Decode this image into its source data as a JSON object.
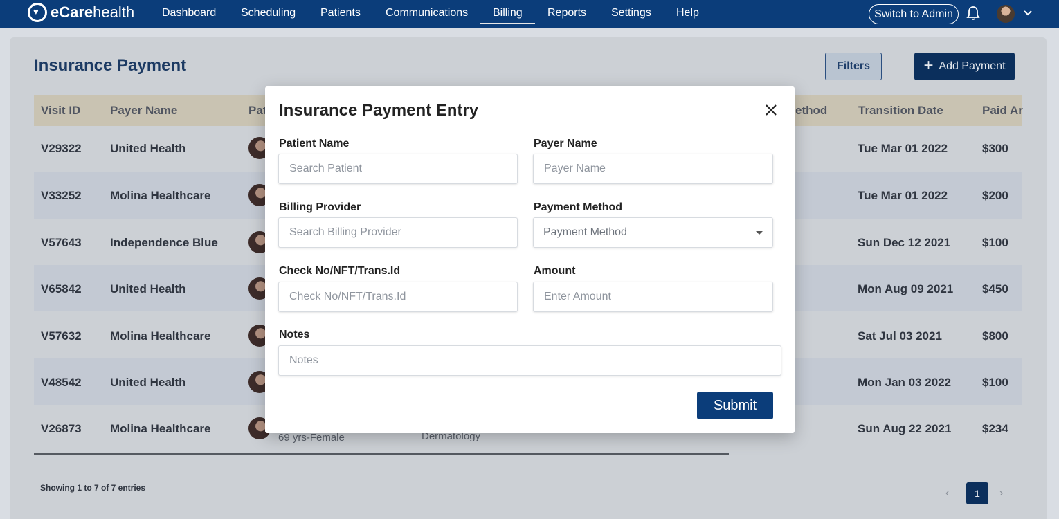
{
  "nav": {
    "brand_bold": "eCare",
    "brand_light": "health",
    "items": [
      "Dashboard",
      "Scheduling",
      "Patients",
      "Communications",
      "Billing",
      "Reports",
      "Settings",
      "Help"
    ],
    "active": "Billing",
    "switch_admin": "Switch to Admin"
  },
  "page": {
    "title": "Insurance Payment",
    "filters_label": "Filters",
    "add_payment_label": "Add Payment"
  },
  "table": {
    "headers": [
      "Visit ID",
      "Payer Name",
      "Pat",
      "ethod",
      "Transition Date",
      "Paid Ar"
    ],
    "rows": [
      {
        "visit_id": "V29322",
        "payer": "United Health",
        "date": "Tue Mar 01 2022",
        "paid": "$300"
      },
      {
        "visit_id": "V33252",
        "payer": "Molina Healthcare",
        "date": "Tue Mar 01 2022",
        "paid": "$200"
      },
      {
        "visit_id": "V57643",
        "payer": "Independence Blue",
        "date": "Sun Dec 12 2021",
        "paid": "$100"
      },
      {
        "visit_id": "V65842",
        "payer": "United Health",
        "date": "Mon Aug 09 2021",
        "paid": "$450"
      },
      {
        "visit_id": "V57632",
        "payer": "Molina Healthcare",
        "date": "Sat Jul 03 2021",
        "paid": "$800"
      },
      {
        "visit_id": "V48542",
        "payer": "United Health",
        "date": "Mon Jan 03 2022",
        "paid": "$100"
      },
      {
        "visit_id": "V26873",
        "payer": "Molina Healthcare",
        "date": "Sun Aug 22 2021",
        "paid": "$234"
      }
    ],
    "last_row_patient_sub": "69 yrs-Female",
    "last_row_specialty": "Dermatology",
    "showing": "Showing 1 to 7 of 7 entries",
    "page_number": "1"
  },
  "modal": {
    "title": "Insurance Payment Entry",
    "patient_name_label": "Patient Name",
    "patient_name_placeholder": "Search Patient",
    "payer_name_label": "Payer Name",
    "payer_name_placeholder": "Payer Name",
    "billing_provider_label": "Billing Provider",
    "billing_provider_placeholder": "Search Billing Provider",
    "payment_method_label": "Payment Method",
    "payment_method_placeholder": "Payment Method",
    "check_label": "Check No/NFT/Trans.Id",
    "check_placeholder": "Check No/NFT/Trans.Id",
    "amount_label": "Amount",
    "amount_placeholder": "Enter Amount",
    "notes_label": "Notes",
    "notes_placeholder": "Notes",
    "submit_label": "Submit"
  },
  "icons": {
    "logo": "heart-logo-icon",
    "bell": "bell-icon",
    "user_avatar": "avatar",
    "chevron": "chevron-down-icon",
    "close": "close-icon",
    "plus": "plus-icon",
    "prev": "chevron-left-icon",
    "next": "chevron-right-icon"
  },
  "colors": {
    "nav_bg": "#0b3d7a",
    "primary_button": "#0b3d7a",
    "title_text": "#1c3a63"
  }
}
